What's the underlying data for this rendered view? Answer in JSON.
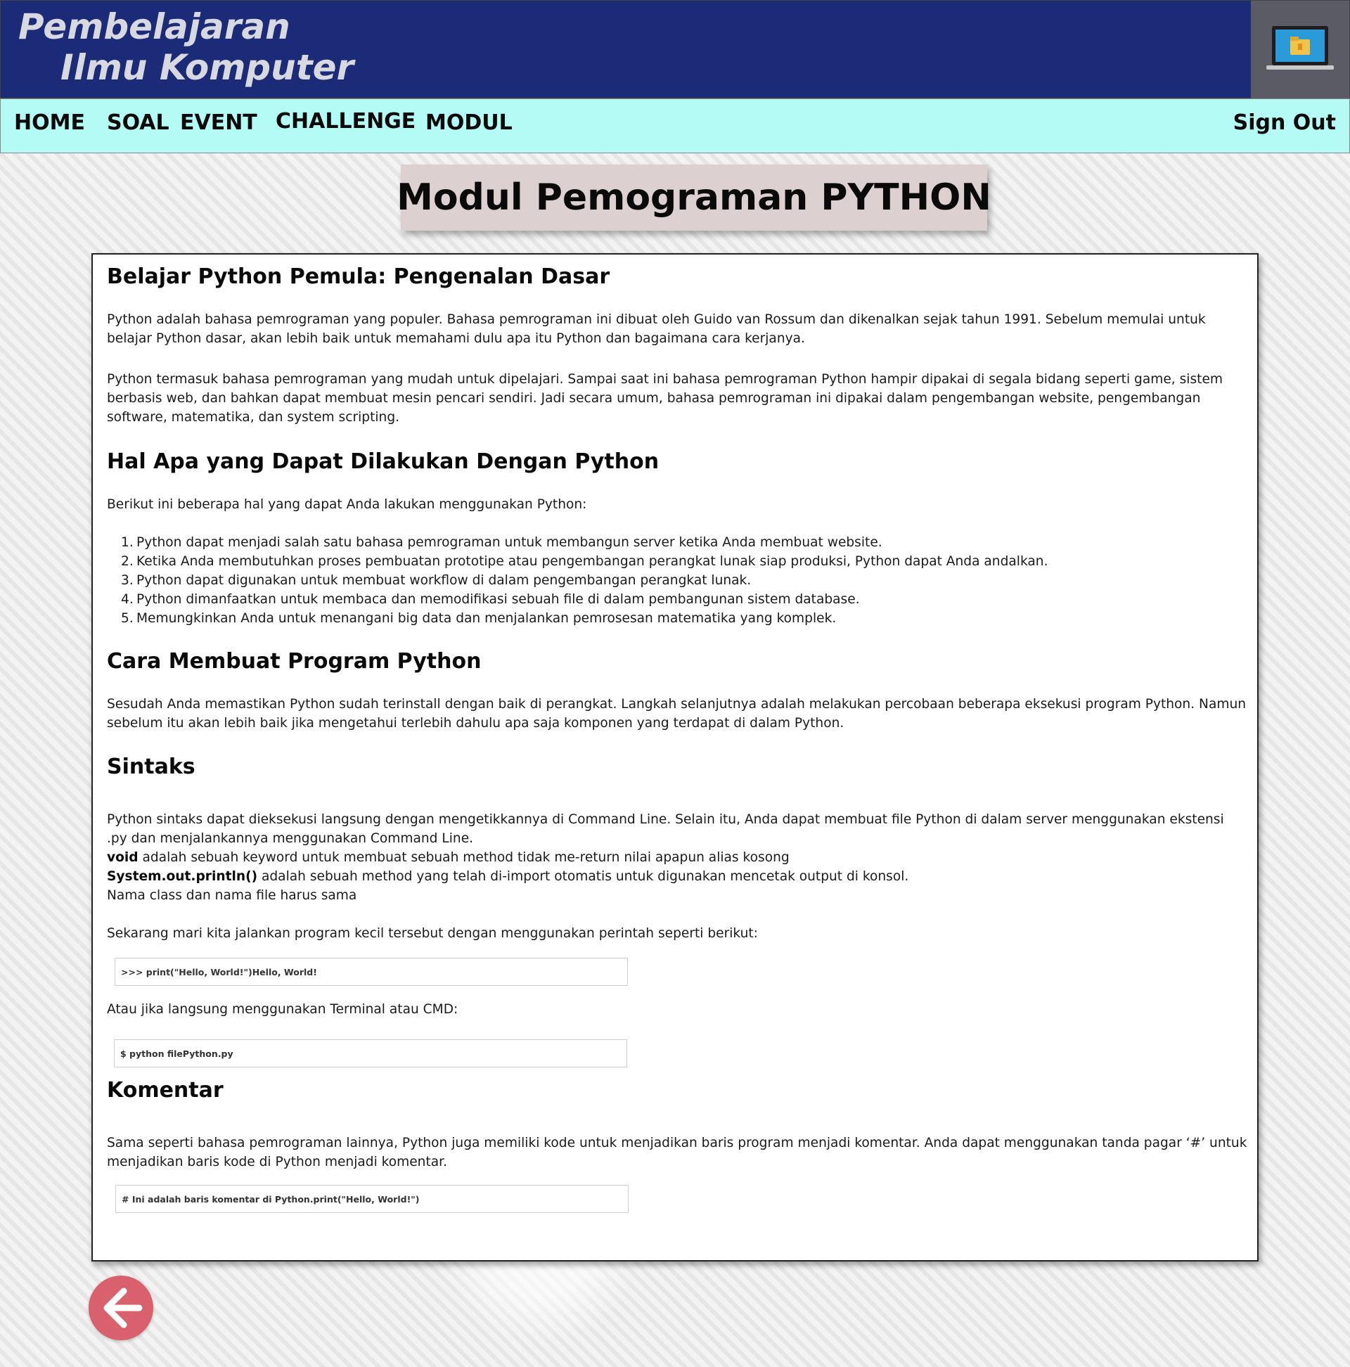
{
  "brand": {
    "line1": "Pembelajaran",
    "line2": "Ilmu Komputer"
  },
  "nav": {
    "home": "HOME",
    "soal": "SOAL",
    "event": "EVENT",
    "challenge": "CHALLENGE",
    "modul": "MODUL",
    "signout": "Sign Out"
  },
  "page_title": "Modul Pemograman PYTHON",
  "sections": {
    "intro": {
      "heading": "Belajar Python Pemula: Pengenalan Dasar",
      "p1": "Python adalah bahasa pemrograman yang populer. Bahasa pemrograman ini dibuat oleh Guido van Rossum dan dikenalkan sejak tahun 1991. Sebelum memulai untuk belajar Python dasar, akan lebih baik untuk memahami dulu apa itu Python dan bagaimana cara kerjanya.",
      "p2": "Python termasuk bahasa pemrograman yang mudah untuk dipelajari. Sampai saat ini bahasa pemrograman Python hampir dipakai di segala bidang seperti game, sistem berbasis web, dan bahkan dapat membuat mesin pencari sendiri. Jadi secara umum, bahasa pemrograman ini dipakai dalam pengembangan website, pengembangan software, matematika, dan system scripting."
    },
    "uses": {
      "heading": "Hal Apa yang Dapat Dilakukan Dengan Python",
      "intro": "Berikut ini beberapa hal yang dapat Anda lakukan menggunakan Python:",
      "items": [
        "Python dapat menjadi salah satu bahasa pemrograman untuk membangun server ketika Anda membuat website.",
        "Ketika Anda membutuhkan proses pembuatan prototipe atau pengembangan perangkat lunak siap produksi, Python dapat Anda andalkan.",
        "Python dapat digunakan untuk membuat workflow di dalam pengembangan perangkat lunak.",
        "Python dimanfaatkan untuk membaca dan memodifikasi sebuah file di dalam pembangunan sistem database.",
        "Memungkinkan Anda untuk menangani big data dan menjalankan pemrosesan matematika yang komplek."
      ]
    },
    "create": {
      "heading": "Cara Membuat Program Python",
      "p1": "Sesudah Anda memastikan Python sudah terinstall dengan baik di perangkat. Langkah selanjutnya adalah melakukan percobaan beberapa eksekusi program Python. Namun sebelum itu akan lebih baik jika mengetahui terlebih dahulu apa saja komponen yang terdapat di dalam Python."
    },
    "syntax": {
      "heading": "Sintaks",
      "p1": "Python sintaks dapat dieksekusi langsung dengan mengetikkannya di Command Line. Selain itu, Anda dapat membuat file Python di dalam server menggunakan ekstensi .py dan menjalankannya menggunakan Command Line.",
      "void_kw": "void",
      "void_desc": " adalah sebuah keyword untuk membuat sebuah method tidak me-return nilai apapun alias kosong",
      "println_kw": "System.out.println()",
      "println_desc": " adalah sebuah method yang telah di-import otomatis untuk digunakan mencetak output di konsol.",
      "class_note": "Nama class dan nama file harus sama",
      "run_intro": "Sekarang mari kita jalankan program kecil tersebut dengan menggunakan perintah seperti berikut:",
      "code1": ">>> print(\"Hello, World!\")Hello, World!",
      "terminal_intro": "Atau jika langsung menggunakan Terminal atau CMD:",
      "code2": "$ python filePython.py"
    },
    "comment": {
      "heading": "Komentar",
      "p1": "Sama seperti bahasa pemrograman lainnya, Python juga memiliki kode untuk menjadikan baris program menjadi komentar. Anda dapat menggunakan tanda pagar ‘#’ untuk menjadikan baris kode di Python menjadi komentar.",
      "code": "# Ini adalah baris komentar di Python.print(\"Hello, World!\")"
    }
  },
  "icons": {
    "logo": "laptop-folder-icon",
    "back": "arrow-left-icon"
  },
  "colors": {
    "header_bg": "#1b2b78",
    "nav_bg": "#b5fbf5",
    "title_bg": "#ddd0d0",
    "back_button": "#d9616e"
  }
}
